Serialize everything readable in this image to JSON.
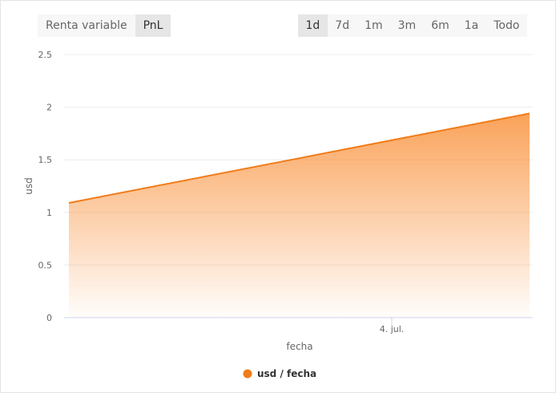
{
  "toolbar": {
    "mode_buttons": [
      {
        "label": "Renta variable",
        "active": false
      },
      {
        "label": "PnL",
        "active": true
      }
    ],
    "range_buttons": [
      {
        "label": "1d",
        "active": true
      },
      {
        "label": "7d",
        "active": false
      },
      {
        "label": "1m",
        "active": false
      },
      {
        "label": "3m",
        "active": false
      },
      {
        "label": "6m",
        "active": false
      },
      {
        "label": "1a",
        "active": false
      },
      {
        "label": "Todo",
        "active": false
      }
    ]
  },
  "chart_data": {
    "type": "area",
    "xlabel": "fecha",
    "ylabel": "usd",
    "x_tick_labels": [
      "4. jul."
    ],
    "y_tick_labels": [
      "0",
      "0.5",
      "1",
      "1.5",
      "2",
      "2.5"
    ],
    "ylim": [
      0,
      2.5
    ],
    "grid": true,
    "legend_position": "bottom-center",
    "series": [
      {
        "name": "usd / fecha",
        "color": "#f07c1a",
        "x": [
          "start",
          "end"
        ],
        "values": [
          1.09,
          1.94
        ]
      }
    ]
  }
}
